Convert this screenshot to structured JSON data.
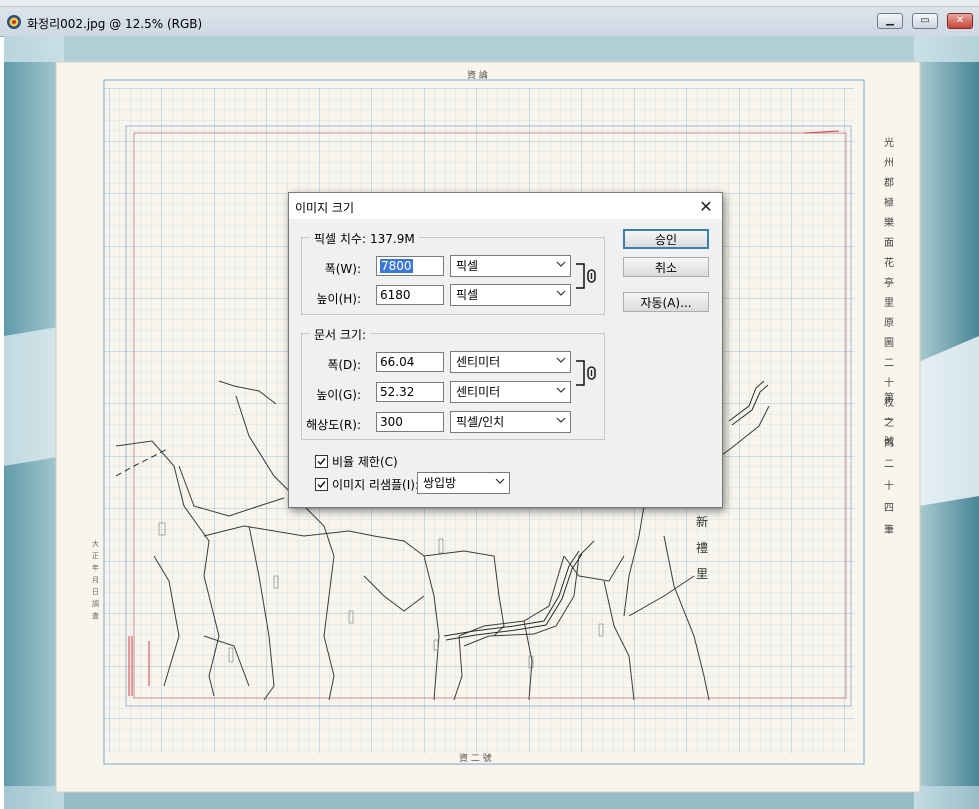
{
  "window": {
    "title": "화정리002.jpg @ 12.5% (RGB)",
    "minimize_icon": "minimize-icon",
    "restore_icon": "restore-icon",
    "close_icon": "close-icon"
  },
  "scan": {
    "top_label": "資 論",
    "bottom_label": "資 二 號",
    "right_column": [
      "光",
      "州",
      "郡",
      "極",
      "樂",
      "面",
      "花",
      "亭",
      "里",
      "原",
      "圖",
      "二",
      "十",
      "枚",
      "之",
      "內",
      "第",
      "一",
      "號",
      "二",
      "十",
      "四",
      "筆"
    ],
    "left_marks": [
      "大",
      "正",
      "年",
      "月",
      "日",
      "調",
      "査"
    ],
    "center_village": [
      "新",
      "禮",
      "里"
    ]
  },
  "dialog": {
    "title": "이미지 크기",
    "close_icon": "close-icon",
    "pixel_group": {
      "label": "픽셀 치수:",
      "value": "137.9M",
      "width_label": "폭(W):",
      "width_value": "7800",
      "width_unit": "픽셀",
      "height_label": "높이(H):",
      "height_value": "6180",
      "height_unit": "픽셀"
    },
    "doc_group": {
      "label": "문서 크기:",
      "width_label": "폭(D):",
      "width_value": "66.04",
      "width_unit": "센티미터",
      "height_label": "높이(G):",
      "height_value": "52.32",
      "height_unit": "센티미터",
      "res_label": "해상도(R):",
      "res_value": "300",
      "res_unit": "픽셀/인치"
    },
    "constrain_label": "비율 제한(C)",
    "resample_label": "이미지 리샘플(I):",
    "resample_method": "쌍입방",
    "buttons": {
      "ok": "승인",
      "cancel": "취소",
      "auto": "자동(A)..."
    }
  }
}
